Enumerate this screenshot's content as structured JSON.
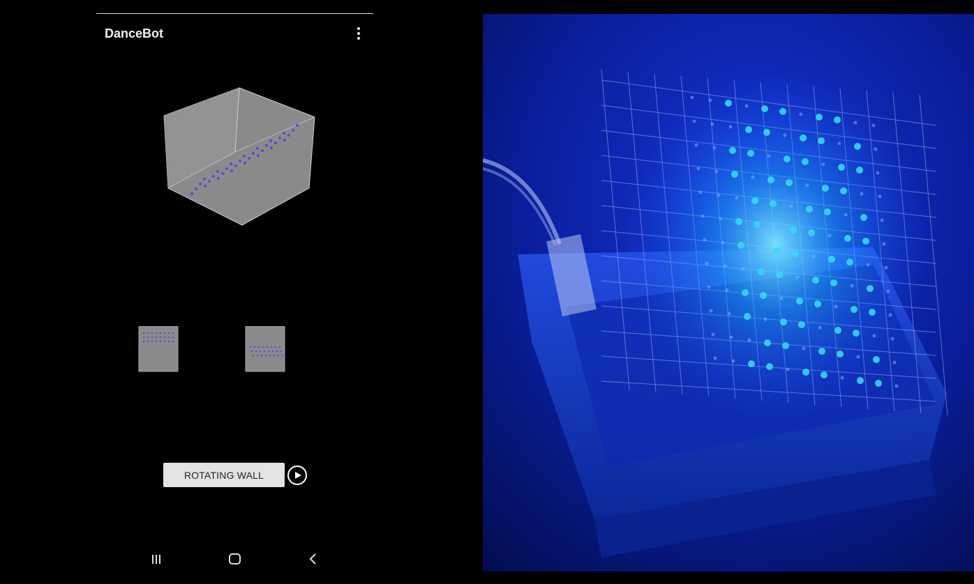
{
  "app": {
    "title": "DanceBot"
  },
  "controls": {
    "pattern_button_label": "ROTATING WALL"
  },
  "icons": {
    "menu": "more-vert-icon",
    "play": "play-circle-icon",
    "nav_recents": "recents-icon",
    "nav_home": "home-icon",
    "nav_back": "back-icon"
  },
  "colors": {
    "background": "#000000",
    "cube_face": "#8a8a8a",
    "led_dot": "#5b4bd9",
    "button_bg": "#e3e3e3",
    "led_glow": "#36d8ff"
  }
}
